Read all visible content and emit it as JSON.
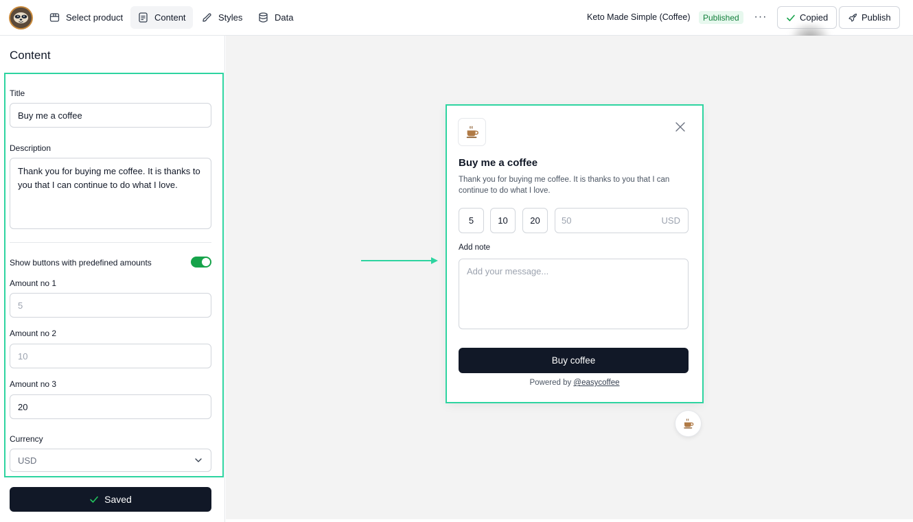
{
  "topbar": {
    "nav": [
      {
        "label": "Select product",
        "icon": "box-icon"
      },
      {
        "label": "Content",
        "icon": "document-icon",
        "active": true
      },
      {
        "label": "Styles",
        "icon": "brush-icon"
      },
      {
        "label": "Data",
        "icon": "database-icon"
      }
    ],
    "project_name": "Keto Made Simple (Coffee)",
    "status_badge": "Published",
    "more_label": "···",
    "copied_label": "Copied",
    "publish_label": "Publish"
  },
  "sidebar": {
    "title": "Content",
    "title_field": {
      "label": "Title",
      "value": "Buy me a coffee"
    },
    "description_field": {
      "label": "Description",
      "value": "Thank you for buying me coffee. It is thanks to you that I can continue to do what I love."
    },
    "toggle": {
      "label": "Show buttons with predefined amounts",
      "on": true
    },
    "amount1": {
      "label": "Amount no 1",
      "value": "5"
    },
    "amount2": {
      "label": "Amount no 2",
      "value": "10"
    },
    "amount3": {
      "label": "Amount no 3",
      "value": "20"
    },
    "currency": {
      "label": "Currency",
      "value": "USD"
    },
    "save_label": "Saved"
  },
  "widget": {
    "title": "Buy me a coffee",
    "description": "Thank you for buying me coffee. It is thanks to you that I can continue to do what I love.",
    "amounts": [
      "5",
      "10",
      "20"
    ],
    "custom_amount_placeholder": "50",
    "currency": "USD",
    "note_label": "Add note",
    "note_placeholder": "Add your message...",
    "buy_label": "Buy coffee",
    "powered_prefix": "Powered by ",
    "powered_link": "@easycoffee"
  },
  "colors": {
    "highlight": "#2dd4a0",
    "primary_dark": "#111827",
    "toggle_on": "#16a34a",
    "badge_bg": "#e7f8ee",
    "badge_text": "#15803d"
  }
}
